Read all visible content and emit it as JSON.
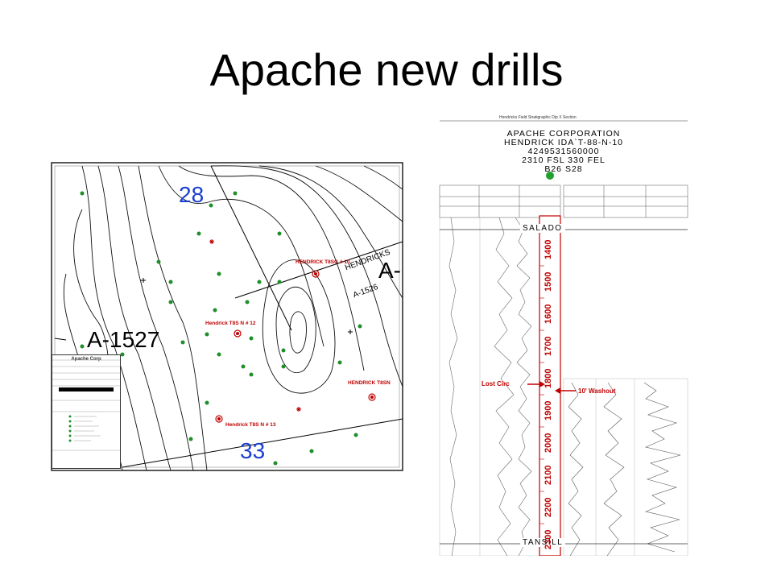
{
  "slide": {
    "title": "Apache new drills"
  },
  "map": {
    "sections": [
      "28",
      "33"
    ],
    "leases": [
      "A-1527",
      "A-"
    ],
    "small_labels": [
      "A-1526",
      "HENDRICKS"
    ],
    "wells": [
      "HENDRICK T8SG # 10",
      "Hendrick T8S N # 12",
      "HENDRICK T8SN",
      "Hendrick T8S N # 13"
    ],
    "legend_title": "Apache Corp"
  },
  "cross_section": {
    "figure_caption": "Hendricks Field Stratigraphic Dip X Section",
    "header": [
      "APACHE CORPORATION",
      "HENDRICK IDA`T-88-N-10",
      "4249531560000",
      "2310 FSL 330 FEL",
      "B26 S28"
    ],
    "formation_tops": [
      "SALADO",
      "TANSILL"
    ],
    "depth_ticks": [
      "1400",
      "1500",
      "1600",
      "1700",
      "1800",
      "1900",
      "2000",
      "2100",
      "2200",
      "2300"
    ],
    "annotations": [
      "Lost Circ",
      "10' Washout"
    ],
    "colors": {
      "depth_track": "#c00000",
      "well_symbol": "#1fa02f"
    }
  }
}
